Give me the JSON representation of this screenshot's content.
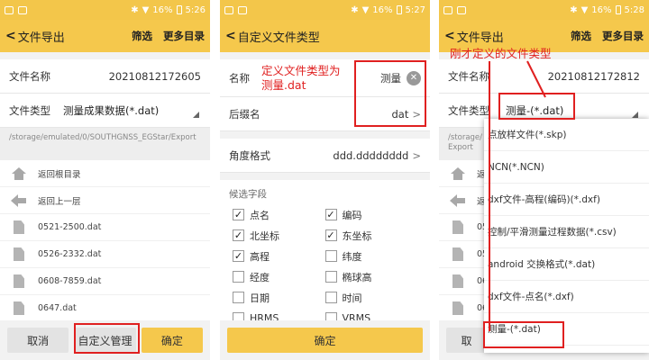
{
  "status": {
    "p1_battery": "16%",
    "p1_time": "5:26",
    "p2_battery": "16%",
    "p2_time": "5:27",
    "p3_battery": "16%",
    "p3_time": "5:28"
  },
  "panel1": {
    "title": "文件导出",
    "filter": "筛选",
    "more": "更多目录",
    "file_name_label": "文件名称",
    "file_name_value": "20210812172605",
    "file_type_label": "文件类型",
    "file_type_value": "测量成果数据(*.dat)",
    "path": "/storage/emulated/0/SOUTHGNSS_EGStar/Export",
    "items": [
      {
        "label": "返回根目录",
        "icon": "home-icon"
      },
      {
        "label": "返回上一层",
        "icon": "back-arrow-icon"
      },
      {
        "label": "0521-2500.dat",
        "icon": "file-icon"
      },
      {
        "label": "0526-2332.dat",
        "icon": "file-icon"
      },
      {
        "label": "0608-7859.dat",
        "icon": "file-icon"
      },
      {
        "label": "0647.dat",
        "icon": "file-icon"
      }
    ],
    "cancel": "取消",
    "custom_manage": "自定义管理",
    "confirm": "确定"
  },
  "panel2": {
    "title": "自定义文件类型",
    "name_label": "名称",
    "name_value": "测量",
    "annotation": "定义文件类型为\n测量.dat",
    "suffix_label": "后缀名",
    "suffix_value": "dat",
    "angle_label": "角度格式",
    "angle_value": "ddd.dddddddd",
    "fields_title": "候选字段",
    "fields": [
      {
        "label": "点名",
        "checked": true
      },
      {
        "label": "编码",
        "checked": true
      },
      {
        "label": "北坐标",
        "checked": true
      },
      {
        "label": "东坐标",
        "checked": true
      },
      {
        "label": "高程",
        "checked": true
      },
      {
        "label": "纬度",
        "checked": false
      },
      {
        "label": "经度",
        "checked": false
      },
      {
        "label": "椭球高",
        "checked": false
      },
      {
        "label": "日期",
        "checked": false
      },
      {
        "label": "时间",
        "checked": false
      },
      {
        "label": "HRMS",
        "checked": false
      },
      {
        "label": "VRMS",
        "checked": false
      }
    ],
    "confirm": "确定"
  },
  "panel3": {
    "title": "文件导出",
    "filter": "筛选",
    "more": "更多目录",
    "annotation": "刚才定义的文件类型",
    "file_name_label": "文件名称",
    "file_name_value": "20210812172812",
    "file_type_label": "文件类型",
    "file_type_value": "测量-(*.dat)",
    "path_partial": "/storage/",
    "path_partial2": "Export",
    "bg_items": [
      "返",
      "返",
      "05",
      "05",
      "06",
      "06"
    ],
    "cancel_partial": "取",
    "options": [
      "点放样文件(*.skp)",
      "NCN(*.NCN)",
      "dxf文件-高程(编码)(*.dxf)",
      "控制/平滑测量过程数据(*.csv)",
      "android 交换格式(*.dat)",
      "dxf文件-点名(*.dxf)",
      "测量-(*.dat)"
    ]
  },
  "colors": {
    "accent": "#f5c84c",
    "annotation_red": "#e02020"
  }
}
